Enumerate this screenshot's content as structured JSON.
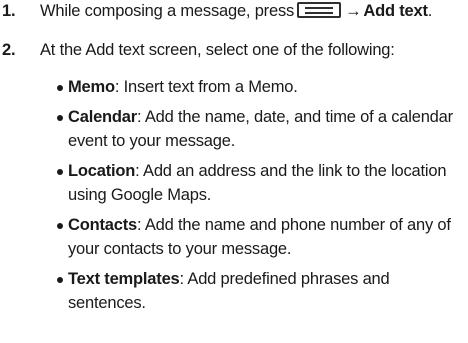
{
  "steps": [
    {
      "number": "1.",
      "before_icon": "While composing a message, press",
      "icon": "menu-key-icon",
      "arrow": "→",
      "action": "Add text",
      "after": "."
    },
    {
      "number": "2.",
      "text": "At the Add text screen, select one of the following:"
    }
  ],
  "options": [
    {
      "term": "Memo",
      "desc": ": Insert text from a Memo."
    },
    {
      "term": "Calendar",
      "desc": ": Add the name, date, and time of a calendar event to your message."
    },
    {
      "term": "Location",
      "desc": ": Add an address and the link to the location using Google Maps."
    },
    {
      "term": "Contacts",
      "desc": ": Add the name and phone number of any of your contacts to your message."
    },
    {
      "term": "Text templates",
      "desc": ": Add predefined phrases and sentences."
    }
  ]
}
